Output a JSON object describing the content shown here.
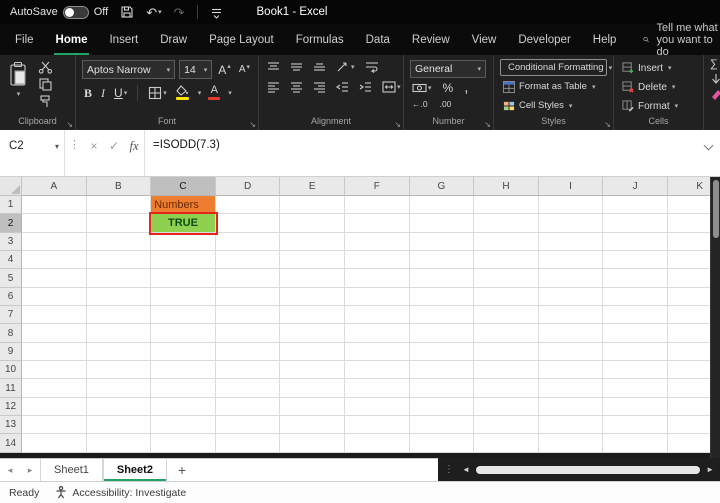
{
  "colors": {
    "accent_green": "#21A366",
    "annotation_red": "#E3251C"
  },
  "icons": {
    "caret_down": "▾",
    "triangle_up": "▴",
    "undo": "↶",
    "redo": "↷",
    "cancel": "×",
    "enter": "✓",
    "ellipsis_v": "⋮",
    "launcher": "↘",
    "tab_prev": "◂",
    "tab_next": "▸",
    "scroll_left": "◄",
    "scroll_right": "►",
    "sum": "∑"
  },
  "titlebar": {
    "autosave_label": "AutoSave",
    "autosave_state": "Off",
    "title": "Book1 - Excel"
  },
  "ribbon_tabs": {
    "items": [
      "File",
      "Home",
      "Insert",
      "Draw",
      "Page Layout",
      "Formulas",
      "Data",
      "Review",
      "View",
      "Developer",
      "Help"
    ],
    "active": "Home"
  },
  "search": {
    "label": "Tell me what you want to do"
  },
  "ribbon": {
    "clipboard": {
      "label": "Clipboard"
    },
    "font": {
      "label": "Font",
      "font_name": "Aptos Narrow",
      "font_size": "14",
      "bold": "B",
      "italic": "I",
      "underline": "U",
      "letter": "A"
    },
    "alignment": {
      "label": "Alignment"
    },
    "number": {
      "label": "Number",
      "format": "General",
      "percent": "%",
      "comma": ",",
      "inc_decimal": "←.0",
      "dec_decimal": ".00"
    },
    "styles": {
      "label": "Styles",
      "conditional": "Conditional Formatting",
      "format_table": "Format as Table",
      "cell_styles": "Cell Styles"
    },
    "cells": {
      "label": "Cells",
      "insert": "Insert",
      "delete": "Delete",
      "format": "Format"
    }
  },
  "formula_bar": {
    "name_box": "C2",
    "formula": "=ISODD(7.3)",
    "fx": "fx"
  },
  "grid": {
    "columns": [
      "A",
      "B",
      "C",
      "D",
      "E",
      "F",
      "G",
      "H",
      "I",
      "J",
      "K"
    ],
    "row_count": 14,
    "active_cell": "C2",
    "highlight_column": "C",
    "highlight_row": 2,
    "cells": [
      {
        "ref": "C1",
        "text": "Numbers",
        "bg": "#ED7D31",
        "color": "#6E2A00",
        "align": "left",
        "bold": false
      },
      {
        "ref": "C2",
        "text": "TRUE",
        "bg": "#90D050",
        "color": "#0B4F14",
        "align": "center",
        "bold": true,
        "annotated": true
      }
    ]
  },
  "sheet_bar": {
    "tabs": [
      "Sheet1",
      "Sheet2"
    ],
    "active": "Sheet2",
    "add_label": "+"
  },
  "status_bar": {
    "mode": "Ready",
    "accessibility": "Accessibility: Investigate"
  }
}
